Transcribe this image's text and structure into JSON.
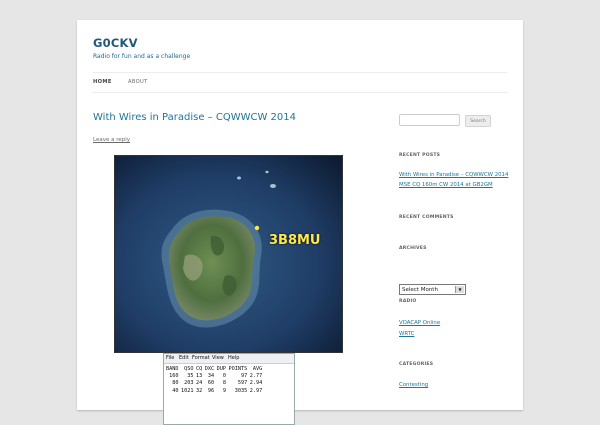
{
  "site": {
    "title": "G0CKV",
    "description": "Radio for fun and as a challenge"
  },
  "nav": {
    "items": [
      {
        "label": "HOME",
        "active": true
      },
      {
        "label": "ABOUT",
        "active": false
      }
    ]
  },
  "post": {
    "title": "With Wires in Paradise – CQWWCW 2014",
    "leave_reply": "Leave a reply",
    "map_label": "3B8MU",
    "score_window": {
      "menu": [
        "File",
        "Edit",
        "Format",
        "View",
        "Help"
      ],
      "headers": [
        "BAND",
        "QSO",
        "CQ",
        "DXC",
        "DUP",
        "POINTS",
        "AVG"
      ],
      "rows": [
        [
          "160",
          "35",
          "13",
          "34",
          "0",
          "97",
          "2.77"
        ],
        [
          "80",
          "203",
          "24",
          "60",
          "8",
          "597",
          "2.94"
        ],
        [
          "40",
          "1021",
          "32",
          "96",
          "9",
          "3035",
          "2.97"
        ]
      ]
    }
  },
  "sidebar": {
    "search_placeholder": "",
    "search_button": "Search",
    "recent_posts_title": "RECENT POSTS",
    "recent_posts": [
      "With Wires in Paradise – CQWWCW 2014",
      "MSE CQ 160m CW 2014 at GB2GM"
    ],
    "recent_comments_title": "RECENT COMMENTS",
    "archives_title": "ARCHIVES",
    "archives_select": "Select Month",
    "radio_title": "RADIO",
    "radio_links": [
      "VOACAP Online",
      "WRTC"
    ],
    "categories_title": "CATEGORIES",
    "categories": [
      "Contesting"
    ]
  },
  "colors": {
    "link": "#21759b",
    "title": "#21587a",
    "background": "#e6e6e6",
    "map_label": "#ffe94a"
  }
}
